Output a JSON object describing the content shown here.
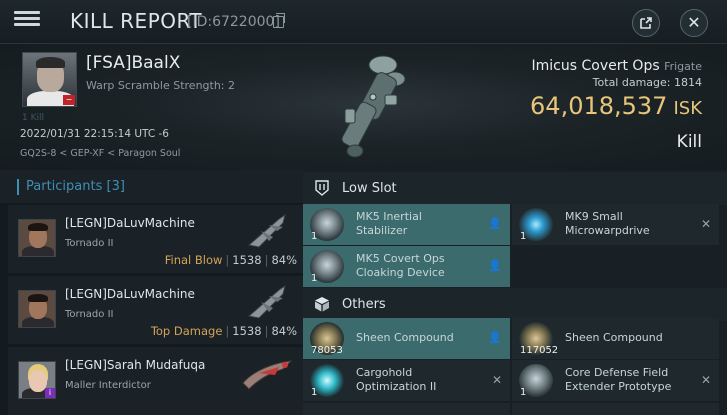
{
  "header": {
    "title": "KILL REPORT",
    "report_id": "[ID:6722000]"
  },
  "victim": {
    "name": "[FSA]BaalX",
    "detail": "Warp Scramble Strength: 2",
    "kills_label": "1 Kill",
    "timestamp": "2022/01/31 22:15:14 UTC -6",
    "location": "GQ2S-8 < GEP-XF < Paragon Soul",
    "ship_name": "Imicus Covert Ops",
    "ship_class": "Frigate",
    "total_damage_label": "Total damage:",
    "total_damage": "1814",
    "isk_value": "64,018,537",
    "isk_unit": "ISK",
    "result": "Kill"
  },
  "participants": {
    "title": "Participants [3]",
    "items": [
      {
        "name": "[LEGN]DaLuvMachine",
        "ship": "Tornado II",
        "role": "Final Blow",
        "damage": "1538",
        "percent": "84%"
      },
      {
        "name": "[LEGN]DaLuvMachine",
        "ship": "Tornado II",
        "role": "Top Damage",
        "damage": "1538",
        "percent": "84%"
      },
      {
        "name": "[LEGN]Sarah Mudafuqa",
        "ship": "Maller Interdictor",
        "role": "",
        "damage": "",
        "percent": ""
      }
    ]
  },
  "fitting": {
    "low_slot_label": "Low Slot",
    "others_label": "Others",
    "low_slot": [
      {
        "name_line1": "MK5 Inertial",
        "name_line2": "Stabilizer",
        "qty": "1",
        "state": "dropped"
      },
      {
        "name_line1": "MK9 Small",
        "name_line2": "Microwarpdrive",
        "qty": "1",
        "state": "destroyed"
      },
      {
        "name_line1": "MK5 Covert Ops",
        "name_line2": "Cloaking Device",
        "qty": "1",
        "state": "dropped"
      }
    ],
    "others": [
      {
        "name_line1": "Sheen Compound",
        "name_line2": "",
        "qty": "78053",
        "state": "dropped"
      },
      {
        "name_line1": "Sheen Compound",
        "name_line2": "",
        "qty": "117052",
        "state": "dropped"
      },
      {
        "name_line1": "Cargohold",
        "name_line2": "Optimization II",
        "qty": "1",
        "state": "destroyed"
      },
      {
        "name_line1": "Core Defense Field",
        "name_line2": "Extender Prototype",
        "qty": "1",
        "state": "destroyed"
      }
    ]
  },
  "colors": {
    "accent": "#3e8fb3",
    "isk": "#e8c57a",
    "role": "#d3a457",
    "dropped_highlight": "#3c6b6e"
  }
}
